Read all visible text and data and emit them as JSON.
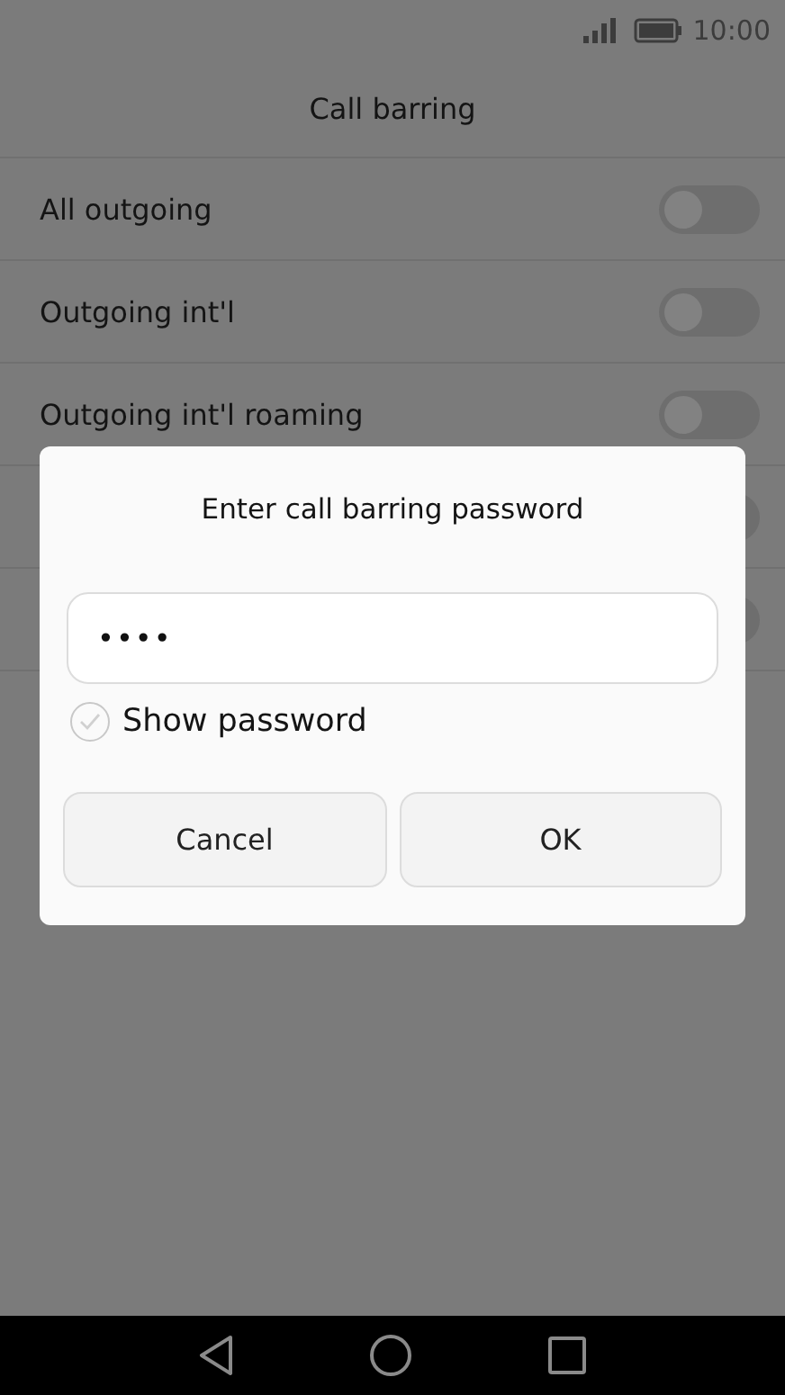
{
  "status_bar": {
    "time": "10:00"
  },
  "title": "Call barring",
  "rows": [
    {
      "label": "All outgoing",
      "on": false
    },
    {
      "label": "Outgoing int'l",
      "on": false
    },
    {
      "label": "Outgoing int'l roaming",
      "on": false
    },
    {
      "on": false
    },
    {
      "on": false
    }
  ],
  "dialog": {
    "title": "Enter call barring password",
    "password": {
      "value": "••••"
    },
    "show_password": {
      "label": "Show password",
      "checked": false
    },
    "buttons": [
      "Cancel",
      "OK"
    ]
  }
}
